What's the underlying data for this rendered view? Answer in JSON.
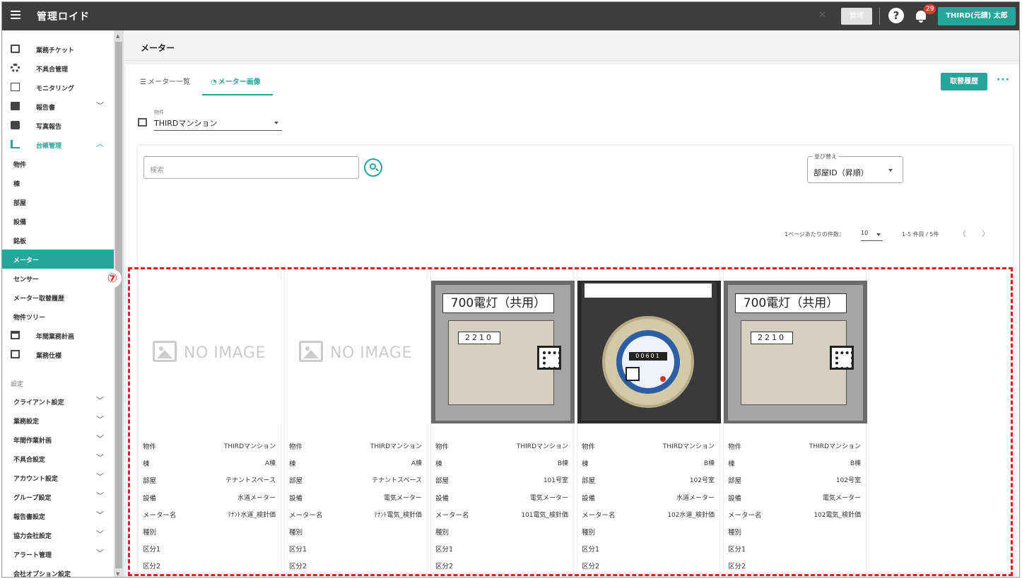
{
  "app": {
    "title": "管理ロイド"
  },
  "topbar": {
    "grey_button": "管理",
    "help": "?",
    "notification_count": "29",
    "user_name": "THIRD(元請) 太郎",
    "accent": "#26a69a",
    "bar_color": "#3d3d3d"
  },
  "sidebar": {
    "items": [
      {
        "label": "業務チケット",
        "icon": "list-box-icon",
        "chevron": ""
      },
      {
        "label": "不具合管理",
        "icon": "gear-icon",
        "chevron": ""
      },
      {
        "label": "モニタリング",
        "icon": "chart-icon",
        "chevron": ""
      },
      {
        "label": "報告書",
        "icon": "document-icon",
        "chevron": "﹀"
      },
      {
        "label": "写真報告",
        "icon": "camera-icon",
        "chevron": ""
      },
      {
        "label": "台帳管理",
        "icon": "books-icon",
        "chevron": "︿"
      }
    ],
    "sub_items": [
      "物件",
      "棟",
      "部屋",
      "設備",
      "銘板",
      "メーター",
      "センサー",
      "メーター取替履歴",
      "物件ツリー"
    ],
    "items2": [
      {
        "label": "年間業務計画",
        "icon": "calendar-icon"
      },
      {
        "label": "業務仕様",
        "icon": "clipboard-icon"
      }
    ],
    "settings_heading": "設定",
    "settings_items": [
      "クライアント設定",
      "業務設定",
      "年間作業計画",
      "不具合設定",
      "アカウント設定",
      "グループ設定",
      "報告書設定",
      "協力会社設定",
      "アラート管理",
      "会社オプション設定"
    ],
    "chevron_down": "﹀"
  },
  "page": {
    "title": "メーター",
    "tabs": [
      {
        "label": "メーター一覧",
        "icon": "list-icon"
      },
      {
        "label": "メーター画像",
        "icon": "gauge-icon"
      }
    ],
    "history_button": "取替履歴",
    "more": "···",
    "property_label": "物件",
    "property_value": "THIRDマンション"
  },
  "search": {
    "placeholder": "検索",
    "sort_label": "並び替え",
    "sort_value": "部屋ID（昇順）"
  },
  "pagination": {
    "per_page_label": "1ページあたりの件数：",
    "per_page_value": "10",
    "range": "1-5 件目 / 5件",
    "prev": "〈",
    "next": "〉"
  },
  "field_labels": [
    "物件",
    "棟",
    "部屋",
    "設備",
    "メーター名",
    "種別",
    "区分1",
    "区分2"
  ],
  "cards": [
    {
      "image": "no-image",
      "no_image_text": "NO IMAGE",
      "values": [
        "THIRDマンション",
        "A棟",
        "テナントスペース",
        "水道メーター",
        "ﾃﾅﾝﾄ水道_検針価",
        "",
        "",
        ""
      ]
    },
    {
      "image": "no-image",
      "no_image_text": "NO IMAGE",
      "values": [
        "THIRDマンション",
        "A棟",
        "テナントスペース",
        "電気メーター",
        "ﾃﾅﾝﾄ電気_検針価",
        "",
        "",
        ""
      ]
    },
    {
      "image": "electric-meter-photo",
      "photo_tag": "700電灯（共用）",
      "photo_digits": "2210",
      "values": [
        "THIRDマンション",
        "B棟",
        "101号室",
        "電気メーター",
        "101電気_検針価",
        "",
        "",
        ""
      ]
    },
    {
      "image": "water-meter-photo",
      "photo_digits": "00601",
      "values": [
        "THIRDマンション",
        "B棟",
        "102号室",
        "水道メーター",
        "102水道_検針価",
        "",
        "",
        ""
      ]
    },
    {
      "image": "electric-meter-photo",
      "photo_tag": "700電灯（共用）",
      "photo_digits": "2210",
      "values": [
        "THIRDマンション",
        "B棟",
        "102号室",
        "電気メーター",
        "102電気_検針価",
        "",
        "",
        ""
      ]
    }
  ],
  "annotation": {
    "number": "⑦",
    "color": "#e02020"
  }
}
